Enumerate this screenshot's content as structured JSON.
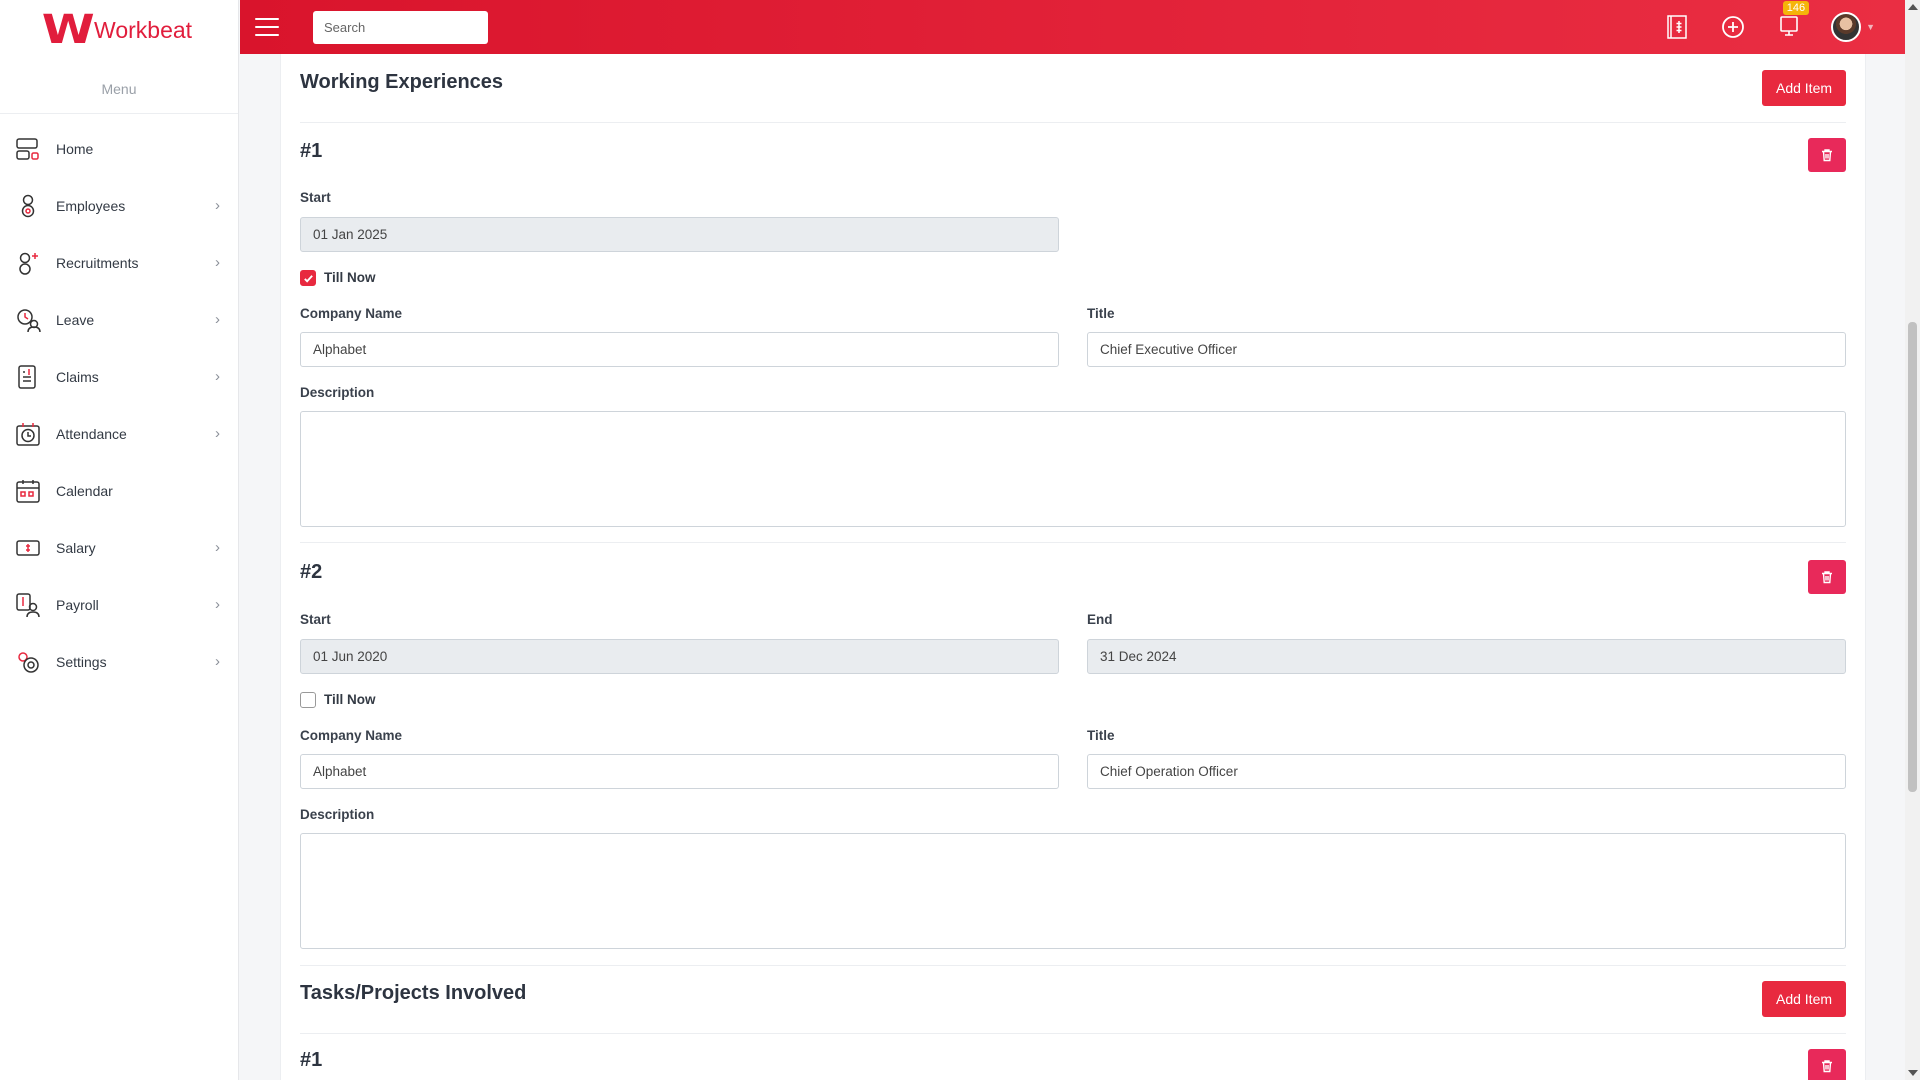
{
  "app": {
    "logo_text": "Workbeat",
    "menu_title": "Menu"
  },
  "sidebar": {
    "items": [
      {
        "label": "Home",
        "icon": "home-icon",
        "has_children": false
      },
      {
        "label": "Employees",
        "icon": "employees-icon",
        "has_children": true
      },
      {
        "label": "Recruitments",
        "icon": "recruitments-icon",
        "has_children": true
      },
      {
        "label": "Leave",
        "icon": "leave-icon",
        "has_children": true
      },
      {
        "label": "Claims",
        "icon": "claims-icon",
        "has_children": true
      },
      {
        "label": "Attendance",
        "icon": "attendance-icon",
        "has_children": true
      },
      {
        "label": "Calendar",
        "icon": "calendar-icon",
        "has_children": false
      },
      {
        "label": "Salary",
        "icon": "salary-icon",
        "has_children": true
      },
      {
        "label": "Payroll",
        "icon": "payroll-icon",
        "has_children": true
      },
      {
        "label": "Settings",
        "icon": "settings-icon",
        "has_children": true
      }
    ]
  },
  "topbar": {
    "search_placeholder": "Search",
    "notification_count": "146"
  },
  "working_experiences": {
    "title": "Working Experiences",
    "add_label": "Add Item",
    "items": [
      {
        "number": "#1",
        "start_label": "Start",
        "start_value": "01 Jan 2025",
        "till_now_label": "Till Now",
        "till_now": true,
        "company_label": "Company Name",
        "company_value": "Alphabet",
        "title_label": "Title",
        "title_value": "Chief Executive Officer",
        "description_label": "Description",
        "description_value": ""
      },
      {
        "number": "#2",
        "start_label": "Start",
        "start_value": "01 Jun 2020",
        "end_label": "End",
        "end_value": "31 Dec 2024",
        "till_now_label": "Till Now",
        "till_now": false,
        "company_label": "Company Name",
        "company_value": "Alphabet",
        "title_label": "Title",
        "title_value": "Chief Operation Officer",
        "description_label": "Description",
        "description_value": ""
      }
    ]
  },
  "tasks_projects": {
    "title": "Tasks/Projects Involved",
    "add_label": "Add Item",
    "items": [
      {
        "number": "#1"
      }
    ]
  },
  "colors": {
    "brand": "#e11d3c",
    "topbar": "#dc1a30",
    "button": "#e8293f",
    "delete": "#e8295a",
    "badge": "#f5b40a"
  }
}
